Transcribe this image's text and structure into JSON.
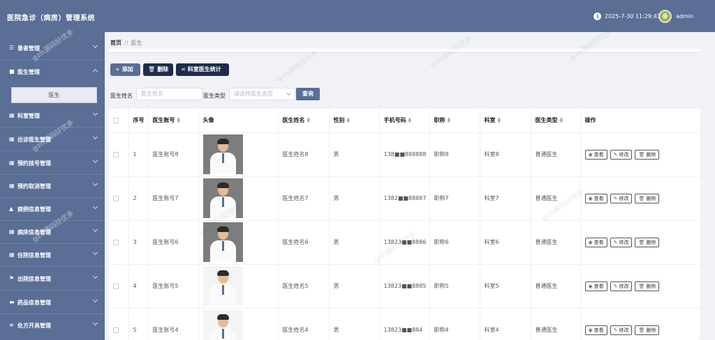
{
  "header": {
    "title": "医院急诊（病房）管理系统",
    "datetime": "2025-7-30 11:29:43",
    "username": "admin"
  },
  "sidebar": {
    "items": [
      {
        "label": "患者管理",
        "icon": "sliders-icon",
        "expanded": false
      },
      {
        "label": "医生管理",
        "icon": "checkbox-icon",
        "expanded": true
      },
      {
        "label": "科室管理",
        "icon": "grid-icon",
        "expanded": false
      },
      {
        "label": "出诊医生管理",
        "icon": "grid-icon",
        "expanded": false
      },
      {
        "label": "预约挂号管理",
        "icon": "grid-icon",
        "expanded": false
      },
      {
        "label": "预约取消管理",
        "icon": "grid-icon",
        "expanded": false
      },
      {
        "label": "病例信息管理",
        "icon": "thumbs-up-icon",
        "expanded": false
      },
      {
        "label": "病床信息管理",
        "icon": "grid-icon",
        "expanded": false
      },
      {
        "label": "住院信息管理",
        "icon": "grid-icon",
        "expanded": false
      },
      {
        "label": "出院信息管理",
        "icon": "flag-icon",
        "expanded": false
      },
      {
        "label": "药品信息管理",
        "icon": "monitor-icon",
        "expanded": false
      },
      {
        "label": "处方开具管理",
        "icon": "list-icon",
        "expanded": false
      }
    ],
    "active_sub": "医生"
  },
  "breadcrumb": {
    "home": "首页",
    "separator": "//",
    "current": "医生"
  },
  "toolbar": {
    "add": "添加",
    "delete": "删除",
    "stats": "科室医生统计"
  },
  "filters": {
    "name_label": "医生姓名",
    "name_placeholder": "医生姓名",
    "type_label": "医生类型",
    "type_placeholder": "请选择医生类型",
    "query": "查询"
  },
  "table": {
    "headers": [
      "序号",
      "医生账号",
      "头像",
      "医生姓名",
      "性别",
      "手机号码",
      "职称",
      "科室",
      "医生类型",
      "操作"
    ],
    "rows": [
      {
        "no": "1",
        "account": "医生账号8",
        "name": "医生姓名8",
        "gender": "男",
        "phone": "138■■888888",
        "title": "职称8",
        "dept": "科室8",
        "type": "普通医生",
        "photo": "gray"
      },
      {
        "no": "2",
        "account": "医生账号7",
        "name": "医生姓名7",
        "gender": "男",
        "phone": "1382■■88887",
        "title": "职称7",
        "dept": "科室7",
        "type": "普通医生",
        "photo": "gray"
      },
      {
        "no": "3",
        "account": "医生账号6",
        "name": "医生姓名6",
        "gender": "男",
        "phone": "13823■■8886",
        "title": "职称6",
        "dept": "科室6",
        "type": "普通医生",
        "photo": "gray"
      },
      {
        "no": "4",
        "account": "医生账号5",
        "name": "医生姓名5",
        "gender": "男",
        "phone": "13823■■8885",
        "title": "职称5",
        "dept": "科室5",
        "type": "普通医生",
        "photo": "white"
      },
      {
        "no": "5",
        "account": "医生账号4",
        "name": "医生姓名4",
        "gender": "男",
        "phone": "13823■■884",
        "title": "职称4",
        "dept": "科室4",
        "type": "普通医生",
        "photo": "white"
      }
    ],
    "actions": {
      "view": "查看",
      "edit": "修改",
      "delete": "删除"
    }
  },
  "watermark": "gzh源码好优多",
  "colors": {
    "sidebar": "#5a6e96",
    "button_dark": "#1f2c4a",
    "background": "#f1f2f6"
  }
}
